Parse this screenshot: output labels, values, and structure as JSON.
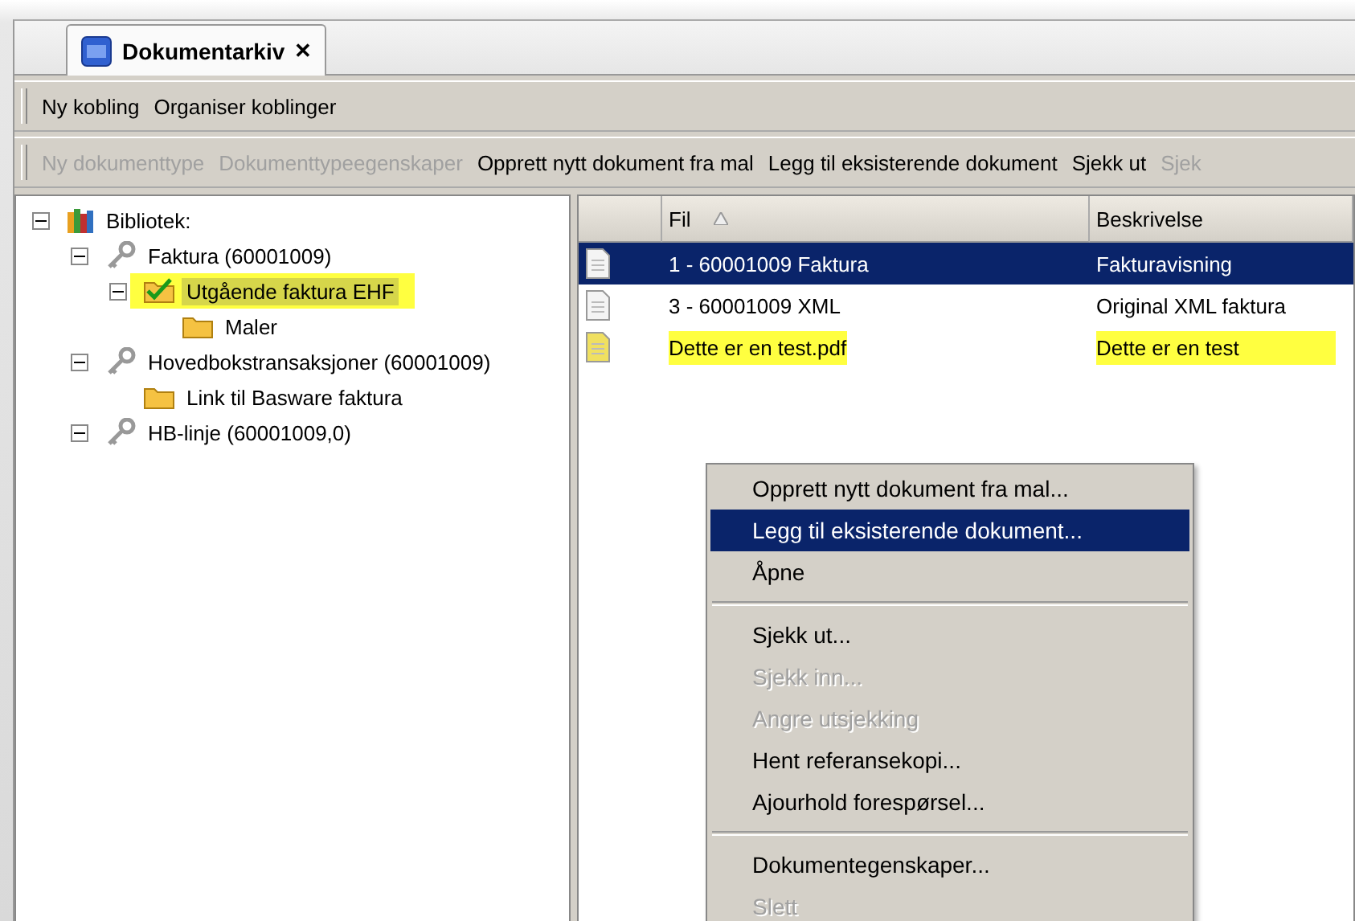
{
  "tab": {
    "title": "Dokumentarkiv",
    "close": "✕",
    "selected": true
  },
  "toolbar_1": [
    {
      "label": "Ny kobling",
      "disabled": false
    },
    {
      "label": "Organiser koblinger",
      "disabled": false
    }
  ],
  "toolbar_2": [
    {
      "label": "Ny dokumenttype",
      "disabled": true
    },
    {
      "label": "Dokumenttypeegenskaper",
      "disabled": true
    },
    {
      "label": "Opprett nytt dokument fra mal",
      "disabled": false
    },
    {
      "label": "Legg til eksisterende dokument",
      "disabled": false
    },
    {
      "label": "Sjekk ut",
      "disabled": false
    },
    {
      "label": "Sjek",
      "disabled": true
    }
  ],
  "tree": [
    {
      "label": "Bibliotek:",
      "kind": "library",
      "expanded": true,
      "highlighted": false,
      "selected": false,
      "children": [
        {
          "label": "Faktura (60001009)",
          "kind": "key",
          "expanded": true,
          "highlighted": false,
          "selected": false,
          "children": [
            {
              "label": "Utgående faktura EHF",
              "kind": "checked-folder",
              "expanded": true,
              "highlighted": true,
              "selected": true,
              "children": [
                {
                  "label": "Maler",
                  "kind": "folder",
                  "highlighted": false,
                  "selected": false
                }
              ]
            }
          ]
        },
        {
          "label": "Hovedbokstransaksjoner (60001009)",
          "kind": "key",
          "expanded": true,
          "highlighted": false,
          "selected": false,
          "children": [
            {
              "label": "Link til Basware faktura",
              "kind": "folder",
              "highlighted": false,
              "selected": false
            }
          ]
        },
        {
          "label": "HB-linje (60001009,0)",
          "kind": "key",
          "expanded": true,
          "highlighted": false,
          "selected": false
        }
      ]
    }
  ],
  "table": {
    "columns": [
      {
        "label": "Fil",
        "sorted": true
      },
      {
        "label": "Beskrivelse"
      }
    ],
    "rows": [
      {
        "fil": "1 - 60001009 Faktura",
        "beskrivelse": "Fakturavisning",
        "selected": true,
        "highlighted": false
      },
      {
        "fil": "3 - 60001009 XML",
        "beskrivelse": "Original XML faktura",
        "selected": false,
        "highlighted": false
      },
      {
        "fil": "Dette er en test.pdf",
        "beskrivelse": "Dette er en test",
        "selected": false,
        "highlighted": true
      }
    ]
  },
  "context_menu": {
    "groups": [
      [
        {
          "label": "Opprett nytt dokument fra mal...",
          "disabled": false,
          "selected": false
        },
        {
          "label": "Legg til eksisterende dokument...",
          "disabled": false,
          "selected": true
        },
        {
          "label": "Åpne",
          "disabled": false,
          "selected": false
        }
      ],
      [
        {
          "label": "Sjekk ut...",
          "disabled": false,
          "selected": false
        },
        {
          "label": "Sjekk inn...",
          "disabled": true,
          "selected": false
        },
        {
          "label": "Angre utsjekking",
          "disabled": true,
          "selected": false
        },
        {
          "label": "Hent referansekopi...",
          "disabled": false,
          "selected": false
        },
        {
          "label": "Ajourhold forespørsel...",
          "disabled": false,
          "selected": false
        }
      ],
      [
        {
          "label": "Dokumentegenskaper...",
          "disabled": false,
          "selected": false
        },
        {
          "label": "Slett",
          "disabled": true,
          "selected": false
        }
      ]
    ]
  }
}
